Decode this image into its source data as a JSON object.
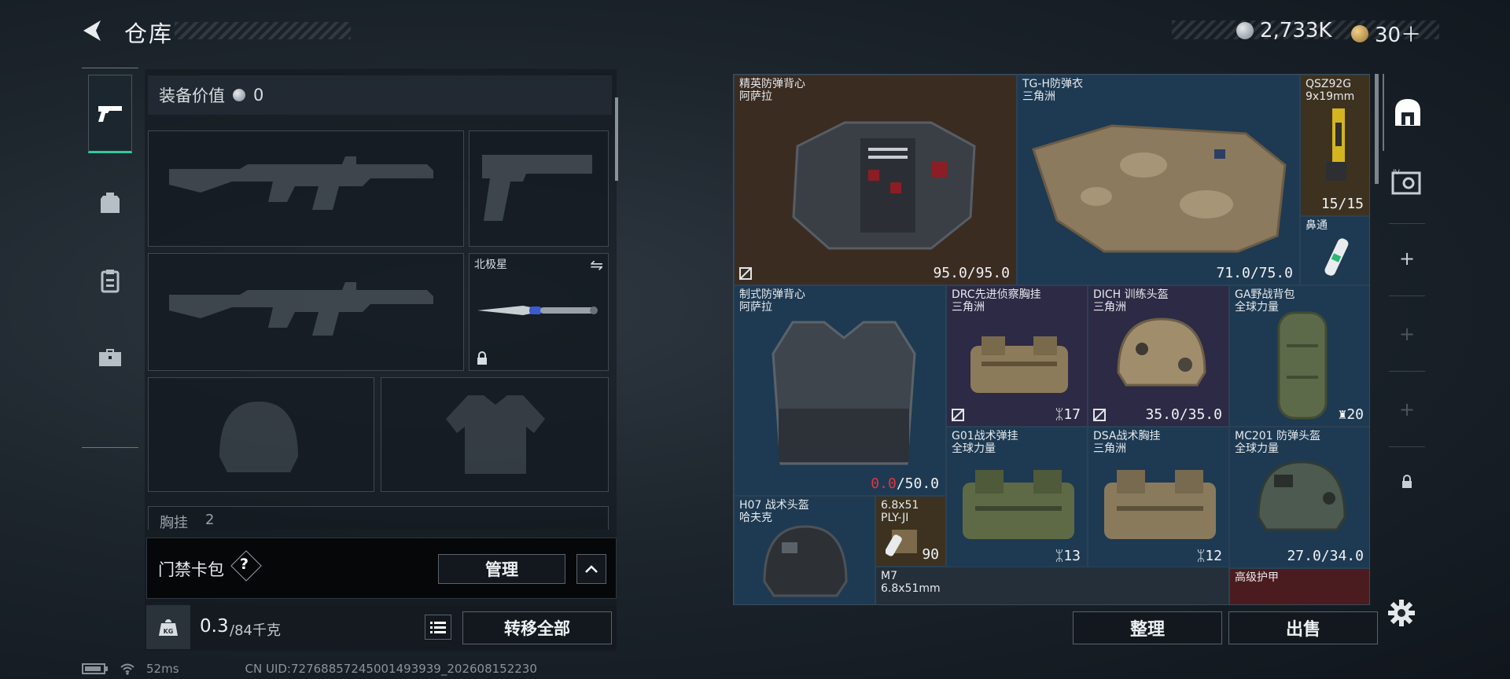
{
  "header": {
    "title": "仓库",
    "currency1": "2,733K",
    "currency2": "30＋"
  },
  "colors": {
    "accent": "#33c99c",
    "warning_red": "#e0353b",
    "grid_bg": "#1a3246"
  },
  "left_tabs": [
    {
      "name": "weapons-tab",
      "icon": "pistol-icon",
      "active": true
    },
    {
      "name": "equipment-tab",
      "icon": "backpack-icon"
    },
    {
      "name": "items-tab",
      "icon": "clipboard-icon"
    },
    {
      "name": "case-tab",
      "icon": "toolbox-icon"
    }
  ],
  "loadout": {
    "value_label": "装备价值",
    "value": "0",
    "melee_slot_name": "北极星",
    "section_label": "胸挂",
    "section_count": "2"
  },
  "keybag": {
    "label": "门禁卡包",
    "help": "?",
    "manage_label": "管理"
  },
  "weight": {
    "current": "0.3",
    "max": "/84千克",
    "transfer_all_label": "转移全部"
  },
  "items": [
    {
      "id": "elite-vest",
      "name": "精英防弹背心",
      "sub": "阿萨拉",
      "stat": "95.0/95.0"
    },
    {
      "id": "tgh-armor",
      "name": "TG-H防弹衣",
      "sub": "三角洲",
      "stat": "71.0/75.0"
    },
    {
      "id": "qsz92g",
      "name": "QSZ92G",
      "sub": "9x19mm",
      "stat": "15/15"
    },
    {
      "id": "nasal",
      "name": "鼻通",
      "sub": "",
      "stat": ""
    },
    {
      "id": "standard-vest",
      "name": "制式防弹背心",
      "sub": "阿萨拉",
      "stat_red": "0.0",
      "stat": "/50.0"
    },
    {
      "id": "drc-rig",
      "name": "DRC先进侦察胸挂",
      "sub": "三角洲",
      "stat": "17"
    },
    {
      "id": "dich-helmet",
      "name": "DICH 训练头盔",
      "sub": "三角洲",
      "stat": "35.0/35.0"
    },
    {
      "id": "ga-pack",
      "name": "GA野战背包",
      "sub": "全球力量",
      "stat": "20"
    },
    {
      "id": "g01-rig",
      "name": "G01战术弹挂",
      "sub": "全球力量",
      "stat": "13"
    },
    {
      "id": "dsa-rig",
      "name": "DSA战术胸挂",
      "sub": "三角洲",
      "stat": "12"
    },
    {
      "id": "mc201",
      "name": "MC201 防弹头盔",
      "sub": "全球力量",
      "stat": "27.0/34.0"
    },
    {
      "id": "h07",
      "name": "H07 战术头盔",
      "sub": "哈夫克",
      "stat": ""
    },
    {
      "id": "ammo-plyn",
      "name": "6.8x51",
      "sub": "PLY-JI",
      "stat": "90"
    },
    {
      "id": "m7",
      "name": "M7",
      "sub": "6.8x51mm",
      "stat": ""
    },
    {
      "id": "adv-armor",
      "name": "高级护甲",
      "sub": "",
      "stat": ""
    }
  ],
  "actions": {
    "sort_label": "整理",
    "sell_label": "出售"
  },
  "status": {
    "ping": "52ms",
    "uid": "CN UID:72768857245001493939_202608152230"
  }
}
